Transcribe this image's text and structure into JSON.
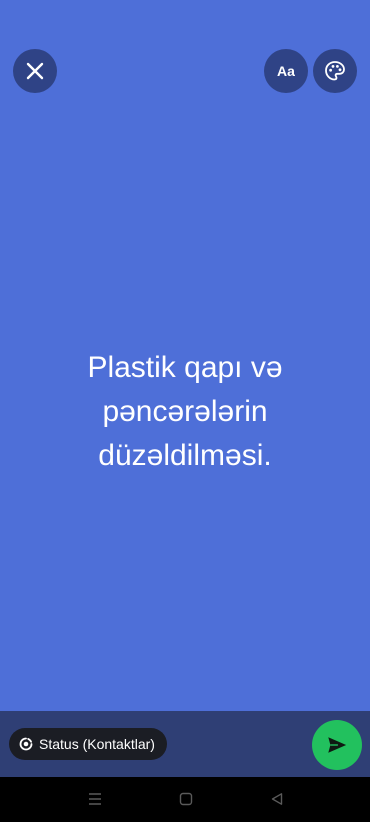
{
  "toolbar": {
    "close_icon": "close-icon",
    "font_label": "Aa",
    "palette_icon": "palette-icon"
  },
  "status": {
    "text": "Plastik qapı və pəncərələrin düzəldilməsi.",
    "background_color": "#4e6fd8"
  },
  "composer": {
    "audience_label": "Status (Kontaktlar)",
    "audience_icon": "status-ring-icon",
    "send_icon": "send-icon",
    "send_color": "#22c15e"
  },
  "nav": {
    "menu_icon": "recent-apps-icon",
    "home_icon": "home-icon",
    "back_icon": "back-icon"
  }
}
